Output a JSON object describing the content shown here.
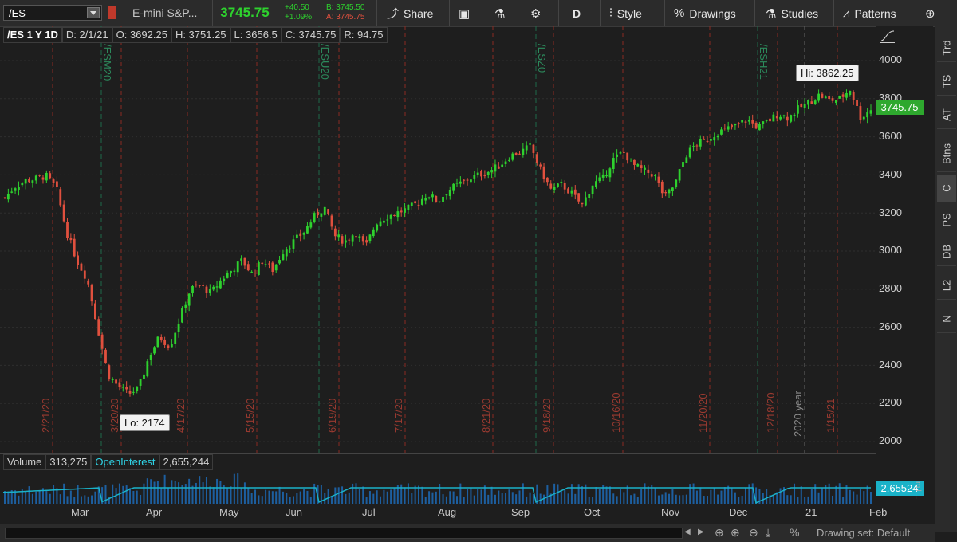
{
  "toolbar": {
    "symbol": "/ES",
    "description": "E-mini S&P...",
    "last_price": "3745.75",
    "change": "+40.50",
    "change_pct": "+1.09%",
    "bid": "B: 3745.50",
    "ask": "A: 3745.75",
    "share_label": "Share",
    "aggregation": "D",
    "style_label": "Style",
    "drawings_label": "Drawings",
    "studies_label": "Studies",
    "patterns_label": "Patterns"
  },
  "info_bar": {
    "symbol_period": "/ES 1 Y 1D",
    "date": "D: 2/1/21",
    "open": "O: 3692.25",
    "high": "H: 3751.25",
    "low": "L: 3656.5",
    "close": "C: 3745.75",
    "range": "R: 94.75"
  },
  "annotations": {
    "high": "Hi: 3862.25",
    "low": "Lo: 2174"
  },
  "price_axis": {
    "labels": [
      "4000",
      "3800",
      "3600",
      "3400",
      "3200",
      "3000",
      "2800",
      "2600",
      "2400",
      "2200",
      "2000"
    ],
    "last_flag": "3745.75",
    "volume_flag": "2.65524"
  },
  "volume_bar": {
    "volume_label": "Volume",
    "volume_value": "313,275",
    "oi_label": "OpenInterest",
    "oi_value": "2,655,244"
  },
  "months": [
    "Mar",
    "Apr",
    "May",
    "Jun",
    "Jul",
    "Aug",
    "Sep",
    "Oct",
    "Nov",
    "Dec",
    "21",
    "Feb"
  ],
  "date_markers": [
    "2/21/20",
    "3/20/20",
    "4/17/20",
    "5/15/20",
    "6/19/20",
    "7/17/20",
    "8/21/20",
    "9/18/20",
    "10/16/20",
    "11/20/20",
    "12/18/20",
    "1/15/21"
  ],
  "expiry_markers": [
    "/ESM20",
    "/ESU20",
    "/ESZ0",
    "/ESH21"
  ],
  "year_marker": "2020 year",
  "right_tabs": [
    "Trd",
    "TS",
    "AT",
    "Btns",
    "C",
    "PS",
    "DB",
    "L2",
    "N"
  ],
  "bottom": {
    "drawing_set": "Drawing set: Default"
  },
  "colors": {
    "up": "#2ed12e",
    "down": "#e0503e",
    "oi": "#1ab2c8",
    "background": "#1e1e1e"
  },
  "chart_data": {
    "type": "candlestick",
    "ylim": [
      2000,
      4000
    ],
    "high_annotation": 3862.25,
    "low_annotation": 2174,
    "last": 3745.75,
    "series": [
      {
        "name": "/ES",
        "close": [
          3280,
          3340,
          3370,
          3380,
          3395,
          3330,
          3100,
          2950,
          2850,
          2600,
          2350,
          2290,
          2250,
          2280,
          2450,
          2550,
          2500,
          2650,
          2800,
          2820,
          2780,
          2850,
          2900,
          2950,
          2880,
          2950,
          2900,
          3000,
          3050,
          3100,
          3180,
          3230,
          3080,
          3050,
          3100,
          3020,
          3150,
          3180,
          3200,
          3220,
          3250,
          3300,
          3260,
          3320,
          3350,
          3380,
          3400,
          3420,
          3450,
          3500,
          3520,
          3550,
          3420,
          3320,
          3350,
          3300,
          3240,
          3350,
          3380,
          3480,
          3520,
          3450,
          3420,
          3400,
          3280,
          3350,
          3500,
          3560,
          3580,
          3620,
          3640,
          3660,
          3690,
          3650,
          3680,
          3720,
          3700,
          3750,
          3780,
          3820,
          3790,
          3800,
          3850,
          3700,
          3745
        ]
      }
    ]
  }
}
